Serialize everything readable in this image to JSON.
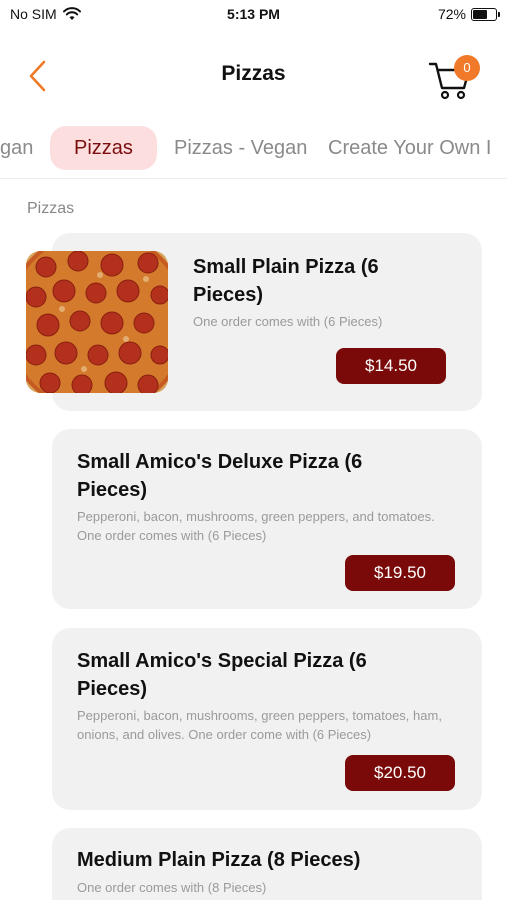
{
  "status_bar": {
    "carrier": "No SIM",
    "time": "5:13 PM",
    "battery_percent": "72%",
    "battery_level": 0.72
  },
  "header": {
    "title": "Pizzas",
    "cart_count": "0"
  },
  "tabs": [
    {
      "label": "gan",
      "active": false
    },
    {
      "label": "Pizzas",
      "active": true
    },
    {
      "label": "Pizzas - Vegan",
      "active": false
    },
    {
      "label": "Create Your Own I",
      "active": false
    }
  ],
  "section": {
    "label": "Pizzas"
  },
  "items": [
    {
      "name": "Small Plain Pizza (6 Pieces)",
      "description": "One order comes with (6 Pieces)",
      "price": "$14.50",
      "has_image": true
    },
    {
      "name": "Small Amico's Deluxe Pizza (6 Pieces)",
      "description": "Pepperoni, bacon, mushrooms, green peppers, and tomatoes. One order comes with (6 Pieces)",
      "price": "$19.50",
      "has_image": false
    },
    {
      "name": "Small Amico's Special Pizza (6 Pieces)",
      "description": "Pepperoni, bacon, mushrooms, green peppers, tomatoes, ham, onions, and olives. One order come with (6 Pieces)",
      "price": "$20.50",
      "has_image": false
    },
    {
      "name": "Medium Plain Pizza (8 Pieces)",
      "description": "One order comes with (8 Pieces)",
      "price": "",
      "has_image": false
    }
  ],
  "colors": {
    "accent_orange": "#f07a2a",
    "price_button": "#7a0a0a",
    "active_tab_bg": "#fcdede",
    "active_tab_text": "#7a0e0e",
    "card_bg": "#f1f1f1"
  },
  "icons": {
    "back": "chevron-left-icon",
    "cart": "shopping-cart-icon",
    "wifi": "wifi-icon",
    "battery": "battery-icon"
  }
}
